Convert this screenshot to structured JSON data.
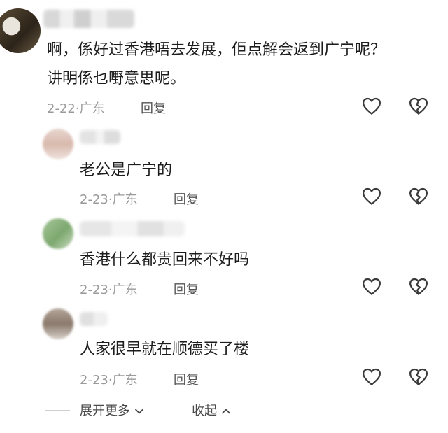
{
  "comments": [
    {
      "text_line1": "啊，係好过香港唔去发展，佢点解会返到广宁呢？",
      "text_line2": "讲明係乜嘢意思呢。",
      "date": "2-22",
      "location": "广东",
      "reply": "回复"
    },
    {
      "text_line1": "老公是广宁的",
      "date": "2-23",
      "location": "广东",
      "reply": "回复"
    },
    {
      "text_line1": "香港什么都贵回来不好吗",
      "date": "2-23",
      "location": "广东",
      "reply": "回复"
    },
    {
      "text_line1": "人家很早就在顺德买了楼",
      "date": "2-23",
      "location": "广东",
      "reply": "回复"
    }
  ],
  "footer": {
    "expand_label": "展开更多",
    "collapse_label": "收起"
  },
  "icons": {
    "like": "heart-icon",
    "dislike": "broken-heart-icon",
    "expand": "chevron-down-icon",
    "collapse": "chevron-up-icon"
  },
  "colors": {
    "text": "#1c1c1c",
    "meta": "#9a9a9a",
    "icon": "#3a3a3a"
  }
}
